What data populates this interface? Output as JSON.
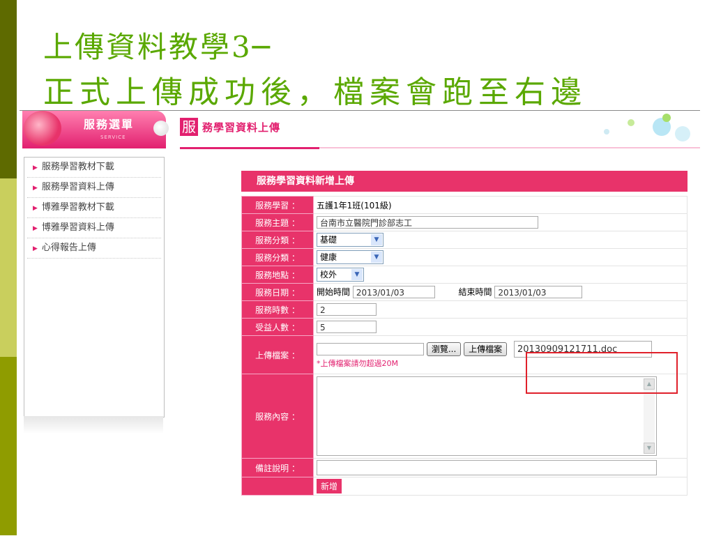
{
  "slide": {
    "title_line1": "上傳資料教學3─",
    "title_line2": "正式上傳成功後，檔案會跑至右邊"
  },
  "menu": {
    "title": "服務選單",
    "subtitle": "SERVICE",
    "items": [
      {
        "label": "服務學習教材下載"
      },
      {
        "label": "服務學習資料上傳"
      },
      {
        "label": "博雅學習教材下載"
      },
      {
        "label": "博雅學習資料上傳"
      },
      {
        "label": "心得報告上傳"
      }
    ]
  },
  "content": {
    "badge": "服",
    "heading": "務學習資料上傳",
    "form_title": "服務學習資料新增上傳"
  },
  "form": {
    "class_label": "服務學習 ：",
    "class_value": "五護1年1班(101級)",
    "topic_label": "服務主題 ：",
    "topic_value": "台南市立醫院門診部志工",
    "cat1_label": "服務分類 ：",
    "cat1_value": "基礎",
    "cat2_label": "服務分類 ：",
    "cat2_value": "健康",
    "place_label": "服務地點 ：",
    "place_value": "校外",
    "date_label": "服務日期 ：",
    "start_label": "開始時間",
    "start_value": "2013/01/03",
    "end_label": "結束時間",
    "end_value": "2013/01/03",
    "hours_label": "服務時數 ：",
    "hours_value": "2",
    "people_label": "受益人數 ：",
    "people_value": "5",
    "upload_label": "上傳檔案 ：",
    "browse_label": "瀏覽...",
    "upload_button": "上傳檔案",
    "uploaded_file": "20130909121711.doc",
    "upload_note": "*上傳檔案請勿超過20M",
    "content_label": "服務內容 ：",
    "remark_label": "備註說明 ：",
    "submit_label": "新增"
  },
  "colors": {
    "accent": "#e8336a",
    "title_green": "#5aa800",
    "highlight_red": "#e0202a"
  }
}
